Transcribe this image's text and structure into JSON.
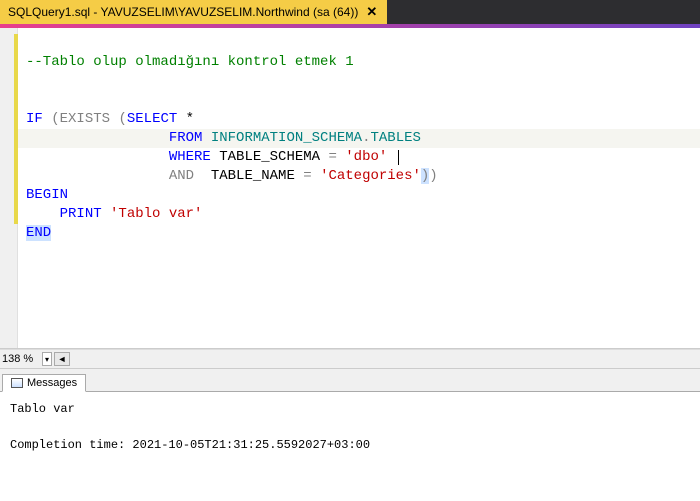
{
  "tab": {
    "title": "SQLQuery1.sql - YAVUZSELIM\\YAVUZSELIM.Northwind (sa (64))",
    "close": "✕"
  },
  "code": {
    "l1_comment": "--Tablo olup olmadığını kontrol etmek 1",
    "l3_if": "IF",
    "l3_open": " (",
    "l3_exists": "EXISTS",
    "l3_open2": " (",
    "l3_select": "SELECT",
    "l3_star": " *",
    "l4_from": "FROM",
    "l4_obj": " INFORMATION_SCHEMA",
    "l4_dot": ".",
    "l4_tables": "TABLES",
    "l5_where": "WHERE",
    "l5_col": " TABLE_SCHEMA ",
    "l5_eq": "=",
    "l5_str": " 'dbo'",
    "l6_and": "AND",
    "l6_col": "  TABLE_NAME ",
    "l6_eq": "=",
    "l6_str": " 'Categories'",
    "l6_close": ")",
    "l6_close2": ")",
    "l7_begin": "BEGIN",
    "l8_print": "PRINT",
    "l8_str": " 'Tablo var'",
    "l9_end": "END"
  },
  "zoom": {
    "value": "138 %",
    "arrow": "▾",
    "left": "◄"
  },
  "messages": {
    "tab_label": "Messages",
    "line1": "Tablo var",
    "line2": "Completion time: 2021-10-05T21:31:25.5592027+03:00"
  }
}
